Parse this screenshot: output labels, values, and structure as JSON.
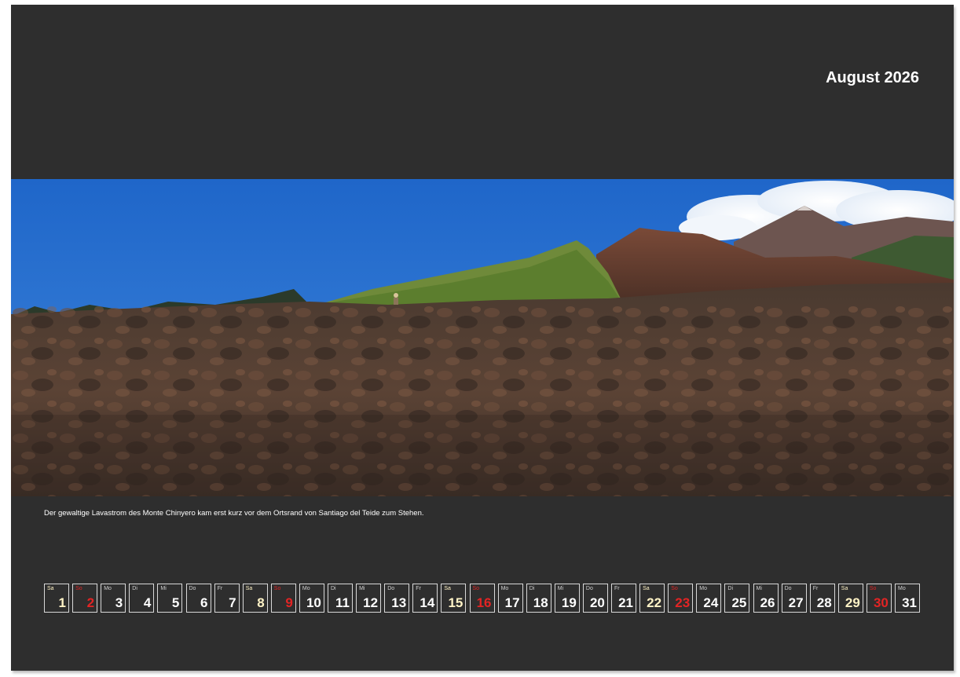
{
  "calendar": {
    "title": "August 2026",
    "caption": "Der gewaltige Lavastrom des Monte Chinyero kam erst kurz vor dem Ortsrand von Santiago del Teide zum Stehen.",
    "days": [
      {
        "wd": "Sa",
        "num": "1",
        "type": "sa"
      },
      {
        "wd": "So",
        "num": "2",
        "type": "so"
      },
      {
        "wd": "Mo",
        "num": "3",
        "type": "wk"
      },
      {
        "wd": "Di",
        "num": "4",
        "type": "wk"
      },
      {
        "wd": "Mi",
        "num": "5",
        "type": "wk"
      },
      {
        "wd": "Do",
        "num": "6",
        "type": "wk"
      },
      {
        "wd": "Fr",
        "num": "7",
        "type": "wk"
      },
      {
        "wd": "Sa",
        "num": "8",
        "type": "sa"
      },
      {
        "wd": "So",
        "num": "9",
        "type": "so"
      },
      {
        "wd": "Mo",
        "num": "10",
        "type": "wk"
      },
      {
        "wd": "Di",
        "num": "11",
        "type": "wk"
      },
      {
        "wd": "Mi",
        "num": "12",
        "type": "wk"
      },
      {
        "wd": "Do",
        "num": "13",
        "type": "wk"
      },
      {
        "wd": "Fr",
        "num": "14",
        "type": "wk"
      },
      {
        "wd": "Sa",
        "num": "15",
        "type": "sa"
      },
      {
        "wd": "So",
        "num": "16",
        "type": "so"
      },
      {
        "wd": "Mo",
        "num": "17",
        "type": "wk"
      },
      {
        "wd": "Di",
        "num": "18",
        "type": "wk"
      },
      {
        "wd": "Mi",
        "num": "19",
        "type": "wk"
      },
      {
        "wd": "Do",
        "num": "20",
        "type": "wk"
      },
      {
        "wd": "Fr",
        "num": "21",
        "type": "wk"
      },
      {
        "wd": "Sa",
        "num": "22",
        "type": "sa"
      },
      {
        "wd": "So",
        "num": "23",
        "type": "so"
      },
      {
        "wd": "Mo",
        "num": "24",
        "type": "wk"
      },
      {
        "wd": "Di",
        "num": "25",
        "type": "wk"
      },
      {
        "wd": "Mi",
        "num": "26",
        "type": "wk"
      },
      {
        "wd": "Do",
        "num": "27",
        "type": "wk"
      },
      {
        "wd": "Fr",
        "num": "28",
        "type": "wk"
      },
      {
        "wd": "Sa",
        "num": "29",
        "type": "sa"
      },
      {
        "wd": "So",
        "num": "30",
        "type": "so"
      },
      {
        "wd": "Mo",
        "num": "31",
        "type": "wk"
      }
    ]
  },
  "colors": {
    "page_background": "#2e2e2e",
    "saturday": "#fff3c6",
    "sunday": "#e32424",
    "weekday": "#ffffff"
  },
  "photo": {
    "subject": "lava-field-landscape"
  }
}
